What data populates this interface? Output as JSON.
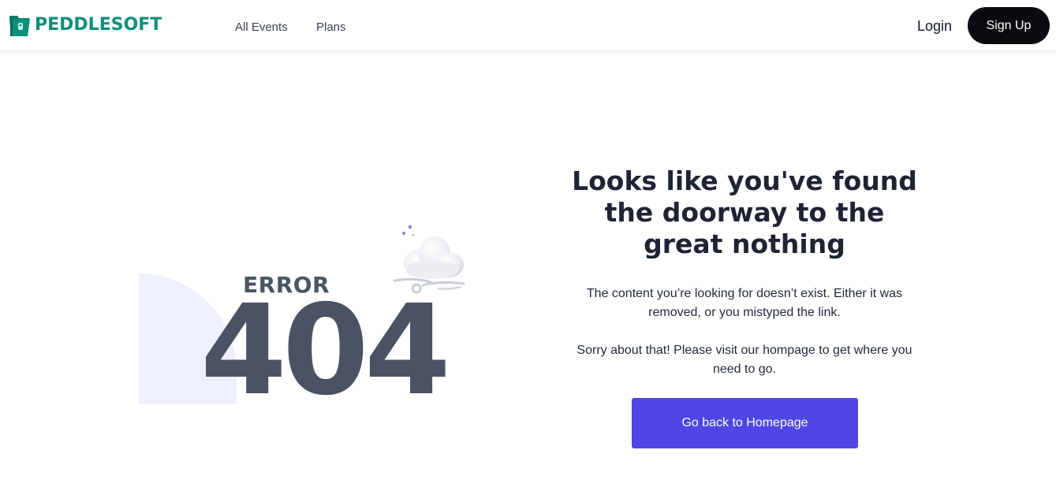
{
  "header": {
    "brand": "PEDDLESOFT",
    "nav": [
      {
        "label": "All Events"
      },
      {
        "label": "Plans"
      }
    ],
    "login_label": "Login",
    "signup_label": "Sign Up"
  },
  "illustration": {
    "error_label": "ERROR",
    "code": "404",
    "icon": "cloud-moon-icon"
  },
  "message": {
    "heading": "Looks like you've found the doorway to the great nothing",
    "paragraph_1": "The content you’re looking for doesn’t exist. Either it was removed, or you mistyped the link.",
    "paragraph_2": "Sorry about that! Please visit our hompage to get where you need to go.",
    "button_label": "Go back to Homepage"
  },
  "colors": {
    "brand": "#0d8f78",
    "primary_button": "#4f46e5",
    "signup_button": "#0b0b0f",
    "code_text": "#4a5363",
    "accent_shape": "#eef1fd"
  }
}
